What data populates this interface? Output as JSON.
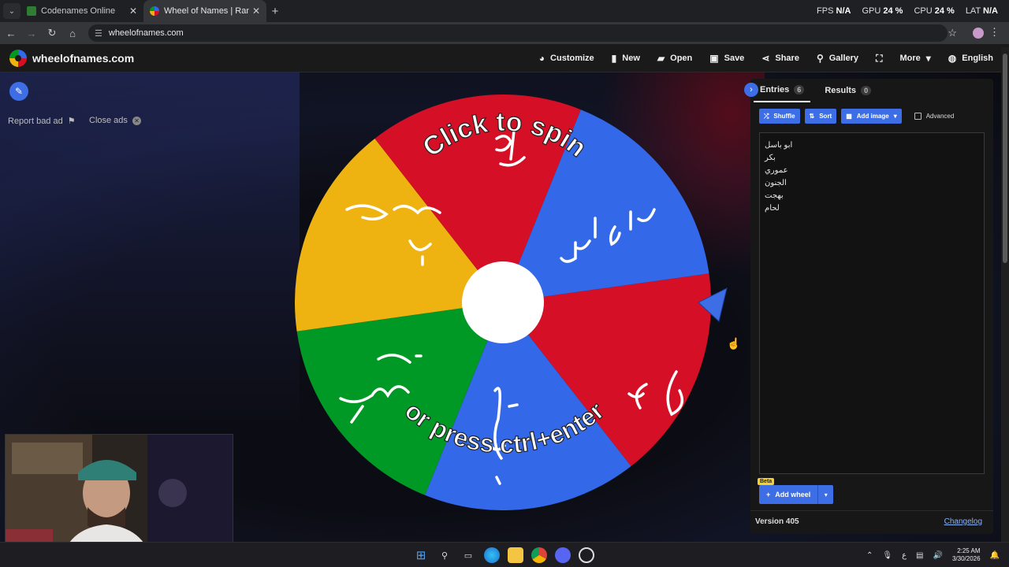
{
  "browser": {
    "tabs": [
      {
        "title": "Codenames Online",
        "color": "#2e7d32"
      },
      {
        "title": "Wheel of Names | Random nam",
        "color": "#3369e8"
      }
    ],
    "url": "wheelofnames.com",
    "stats": {
      "fps_label": "FPS",
      "fps": "N/A",
      "gpu_label": "GPU",
      "gpu": "24 %",
      "cpu_label": "CPU",
      "cpu": "24 %",
      "lat_label": "LAT",
      "lat": "N/A"
    }
  },
  "app": {
    "brand": "wheelofnames.com",
    "menu": {
      "customize": "Customize",
      "new": "New",
      "open": "Open",
      "save": "Save",
      "share": "Share",
      "gallery": "Gallery",
      "more": "More",
      "language": "English"
    }
  },
  "left": {
    "report": "Report bad ad",
    "close_ads": "Close ads"
  },
  "wheel": {
    "colors": {
      "red": "#d50f25",
      "blue": "#3369e8",
      "yellow": "#eeb211",
      "green": "#009925"
    },
    "top_text": "Click to spin",
    "bottom_text": "or press ctrl+enter"
  },
  "panel": {
    "tabs": {
      "entries": "Entries",
      "entries_count": "6",
      "results": "Results",
      "results_count": "0"
    },
    "tools": {
      "shuffle": "Shuffle",
      "sort": "Sort",
      "add_image": "Add image",
      "advanced": "Advanced"
    },
    "entries": [
      "ابو باسل",
      "بكر",
      "عموري",
      "الجنون",
      "بهجت",
      "لحام"
    ],
    "add_wheel": "Add wheel",
    "beta": "Beta",
    "version": "Version 405",
    "changelog": "Changelog"
  },
  "taskbar": {
    "time": "2:25 AM",
    "date": "3/30/2026",
    "lang": "ع"
  }
}
